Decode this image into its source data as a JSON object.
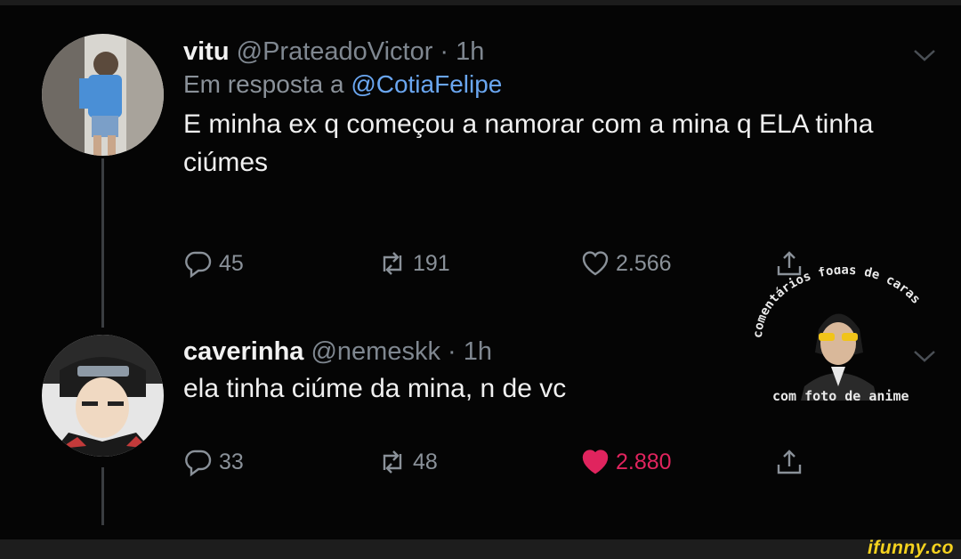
{
  "tweet1": {
    "name": "vitu",
    "handle": "@PrateadoVictor · 1h",
    "reply_prefix": "Em resposta a",
    "reply_mention": "@CotiaFelipe",
    "text": "E minha ex q começou a namorar com a mina q ELA tinha ciúmes",
    "replies": "45",
    "retweets": "191",
    "likes": "2.566"
  },
  "tweet2": {
    "name": "caverinha",
    "handle": "@nemeskk · 1h",
    "text": "ela tinha ciúme da mina, n de vc",
    "replies": "33",
    "retweets": "48",
    "likes": "2.880"
  },
  "sticker": {
    "top_text": "comentários fodas de caras",
    "bottom_text": "com foto de anime"
  },
  "watermark": "ifunny.co",
  "colors": {
    "background": "#050505",
    "mention": "#6aa6f0",
    "liked": "#e0245e",
    "icon": "#8a9199"
  },
  "icons": [
    "reply-icon",
    "retweet-icon",
    "like-icon",
    "share-icon",
    "chevron-down-icon"
  ]
}
